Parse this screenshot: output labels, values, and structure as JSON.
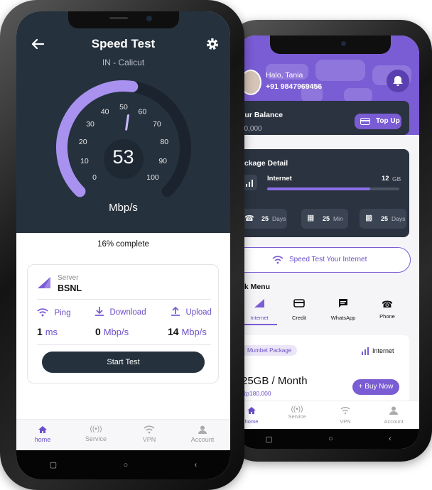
{
  "front": {
    "title": "Speed Test",
    "location": "IN - Calicut",
    "gauge": {
      "value": 53,
      "value_label": "53",
      "max": 100,
      "unit": "Mbp/s",
      "ticks": [
        "0",
        "10",
        "20",
        "30",
        "40",
        "50",
        "60",
        "70",
        "80",
        "90",
        "100"
      ]
    },
    "progress_label": "16% complete",
    "server": {
      "caption": "Server",
      "name": "BSNL"
    },
    "metrics": [
      {
        "label": "Ping",
        "value": "1",
        "unit": "ms",
        "icon": "wifi-icon"
      },
      {
        "label": "Download",
        "value": "0",
        "unit": "Mbp/s",
        "icon": "download-icon"
      },
      {
        "label": "Upload",
        "value": "14",
        "unit": "Mbp/s",
        "icon": "upload-icon"
      }
    ],
    "start_button": "Start Test",
    "tabs": [
      {
        "label": "home",
        "icon": "home-icon",
        "active": true
      },
      {
        "label": "Service",
        "icon": "broadcast-icon",
        "active": false
      },
      {
        "label": "VPN",
        "icon": "wifi-icon",
        "active": false
      },
      {
        "label": "Account",
        "icon": "person-icon",
        "active": false
      }
    ]
  },
  "back": {
    "greeting": "Halo, Tania",
    "phone": "+91 9847969456",
    "balance_title": "our Balance",
    "balance_value": "00,000",
    "topup_label": "Top Up",
    "package_title": "ackage Detail",
    "internet_label": "Internet",
    "internet_value": "12",
    "internet_unit": "GB",
    "internet_fill": 0.78,
    "stats": [
      {
        "value": "25",
        "unit": "Days",
        "icon": "phone-icon"
      },
      {
        "value": "25",
        "unit": "Min",
        "icon": "grid-icon"
      },
      {
        "value": "25",
        "unit": "Days",
        "icon": "chat-icon"
      }
    ],
    "speed_test_button": "Speed Test Your Internet",
    "quick_menu_title": "ck Menu",
    "quick_menu": [
      {
        "label": "Internet",
        "active": true
      },
      {
        "label": "Credit",
        "active": false
      },
      {
        "label": "WhatsApp",
        "active": false
      },
      {
        "label": "Phone",
        "active": false
      }
    ],
    "offer": {
      "badge": "Mumbet Package",
      "type_label": "Internet",
      "title": "25GB / Month",
      "price": "Rp180,000",
      "buy_label": "+ Buy Now"
    },
    "tabs": [
      {
        "label": "home",
        "active": true
      },
      {
        "label": "Service",
        "active": false
      },
      {
        "label": "VPN",
        "active": false
      },
      {
        "label": "Account",
        "active": false
      }
    ]
  },
  "colors": {
    "accent": "#7a5cd4",
    "dark": "#25313d",
    "panel": "#2b3340"
  }
}
